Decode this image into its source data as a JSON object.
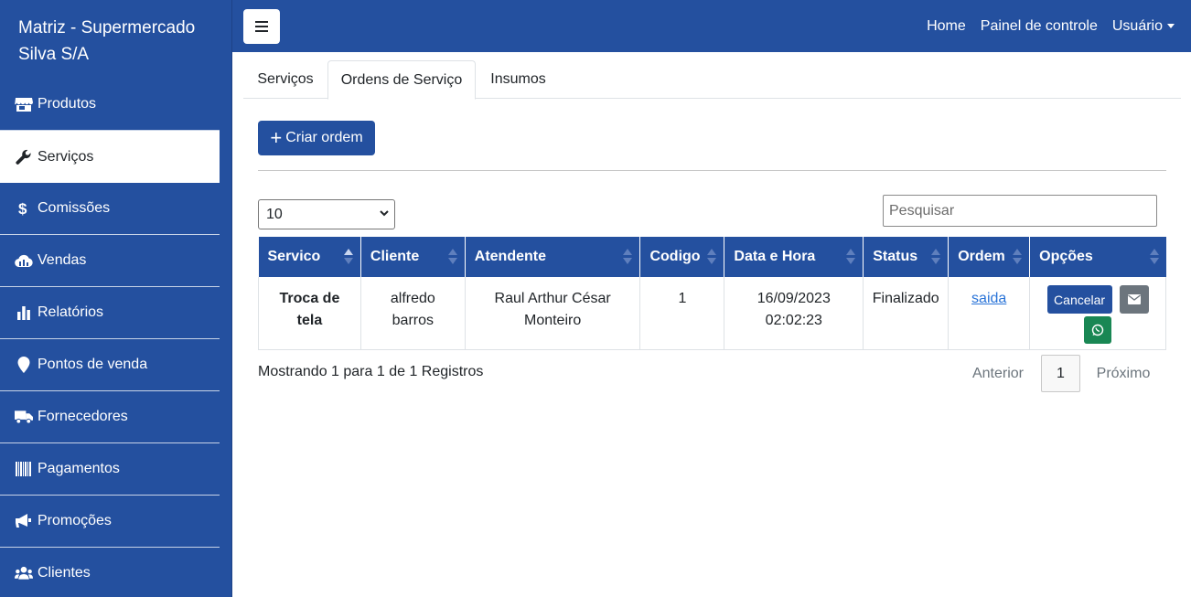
{
  "sidebar": {
    "brand": "Matriz - Supermercado Silva S/A",
    "items": [
      {
        "label": "Produtos",
        "icon": "store-icon"
      },
      {
        "label": "Serviços",
        "icon": "wrench-icon"
      },
      {
        "label": "Comissões",
        "icon": "dollar-icon"
      },
      {
        "label": "Vendas",
        "icon": "cloud-icon"
      },
      {
        "label": "Relatórios",
        "icon": "bar-chart-icon"
      },
      {
        "label": "Pontos de venda",
        "icon": "map-marker-icon"
      },
      {
        "label": "Fornecedores",
        "icon": "truck-icon"
      },
      {
        "label": "Pagamentos",
        "icon": "barcode-icon"
      },
      {
        "label": "Promoções",
        "icon": "megaphone-icon"
      },
      {
        "label": "Clientes",
        "icon": "users-icon"
      }
    ],
    "active_index": 1
  },
  "topbar": {
    "home": "Home",
    "painel": "Painel de controle",
    "usuario": "Usuário"
  },
  "tabs": [
    {
      "label": "Serviços"
    },
    {
      "label": "Ordens de Serviço"
    },
    {
      "label": "Insumos"
    }
  ],
  "active_tab": 1,
  "create_label": "Criar ordem",
  "page_size": "10",
  "search_placeholder": "Pesquisar",
  "table": {
    "headers": [
      "Servico",
      "Cliente",
      "Atendente",
      "Codigo",
      "Data e Hora",
      "Status",
      "Ordem",
      "Opções"
    ],
    "rows": [
      {
        "servico": "Troca de tela",
        "cliente": "alfredo barros",
        "atendente": "Raul Arthur César Monteiro",
        "codigo": "1",
        "data": "16/09/2023 02:02:23",
        "status": "Finalizado",
        "ordem": "saida",
        "cancel": "Cancelar"
      }
    ]
  },
  "info": "Mostrando 1 para 1 de 1 Registros",
  "pagination": {
    "prev": "Anterior",
    "page": "1",
    "next": "Próximo"
  },
  "colors": {
    "primary": "#24509f",
    "secondary": "#6c757d",
    "success": "#198754"
  }
}
